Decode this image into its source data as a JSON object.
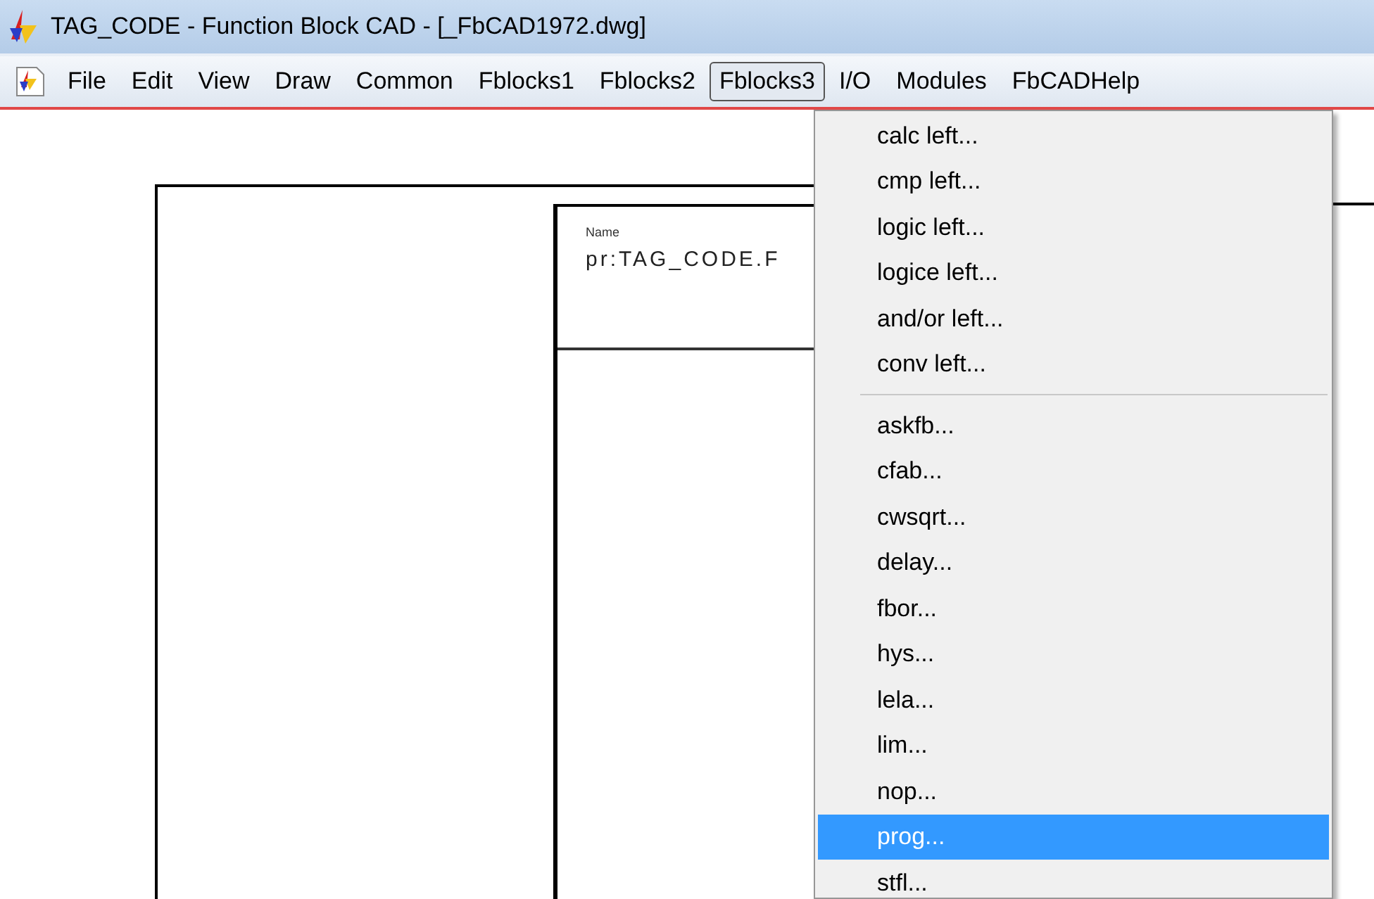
{
  "window": {
    "title": "TAG_CODE - Function Block CAD - [_FbCAD1972.dwg]"
  },
  "menu_bar": [
    {
      "label": "File",
      "selected": false
    },
    {
      "label": "Edit",
      "selected": false
    },
    {
      "label": "View",
      "selected": false
    },
    {
      "label": "Draw",
      "selected": false
    },
    {
      "label": "Common",
      "selected": false
    },
    {
      "label": "Fblocks1",
      "selected": false
    },
    {
      "label": "Fblocks2",
      "selected": false
    },
    {
      "label": "Fblocks3",
      "selected": true
    },
    {
      "label": "I/O",
      "selected": false
    },
    {
      "label": "Modules",
      "selected": false
    },
    {
      "label": "FbCADHelp",
      "selected": false
    }
  ],
  "dropdown": {
    "sections": [
      {
        "items": [
          {
            "label": "calc left...",
            "selected": false
          },
          {
            "label": "cmp left...",
            "selected": false
          },
          {
            "label": "logic left...",
            "selected": false
          },
          {
            "label": "logice left...",
            "selected": false
          },
          {
            "label": "and/or left...",
            "selected": false
          },
          {
            "label": "conv left...",
            "selected": false
          }
        ]
      },
      {
        "items": [
          {
            "label": "askfb...",
            "selected": false
          },
          {
            "label": "cfab...",
            "selected": false
          },
          {
            "label": "cwsqrt...",
            "selected": false
          },
          {
            "label": "delay...",
            "selected": false
          },
          {
            "label": "fbor...",
            "selected": false
          },
          {
            "label": "hys...",
            "selected": false
          },
          {
            "label": "lela...",
            "selected": false
          },
          {
            "label": "lim...",
            "selected": false
          },
          {
            "label": "nop...",
            "selected": false
          },
          {
            "label": "prog...",
            "selected": true
          },
          {
            "label": "stfl...",
            "selected": false
          }
        ]
      }
    ]
  },
  "drawing": {
    "title_block": {
      "label": "Name",
      "value": "pr:TAG_CODE.F"
    }
  }
}
